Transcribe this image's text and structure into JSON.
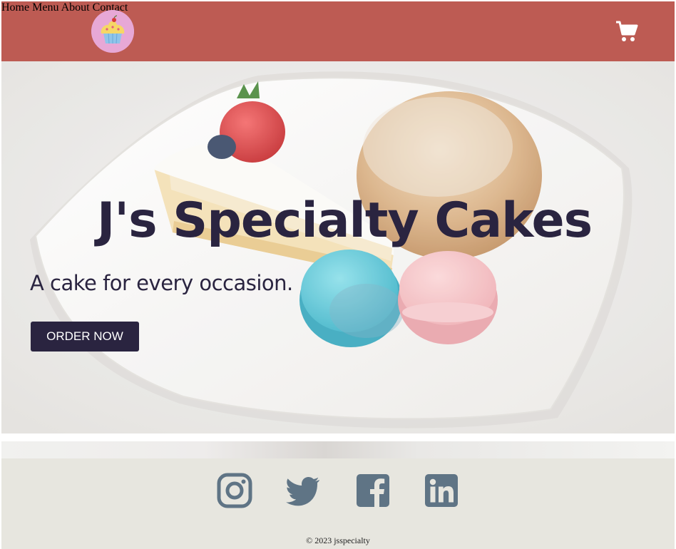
{
  "header": {
    "logo_icon": "cupcake-icon",
    "nav": [
      {
        "label": "Home"
      },
      {
        "label": "Menu"
      },
      {
        "label": "About"
      },
      {
        "label": "Contact"
      }
    ],
    "cart_icon": "cart-icon",
    "background_color": "#bd5b53"
  },
  "hero": {
    "title": "J's Specialty Cakes",
    "subtitle": "A cake for every occasion.",
    "cta_label": "ORDER NOW",
    "text_color": "#2a2440"
  },
  "footer": {
    "social_icons": [
      "instagram-icon",
      "twitter-icon",
      "facebook-icon",
      "linkedin-icon"
    ],
    "copyright": "© 2023 jsspecialty",
    "icon_color": "#5f7485"
  }
}
